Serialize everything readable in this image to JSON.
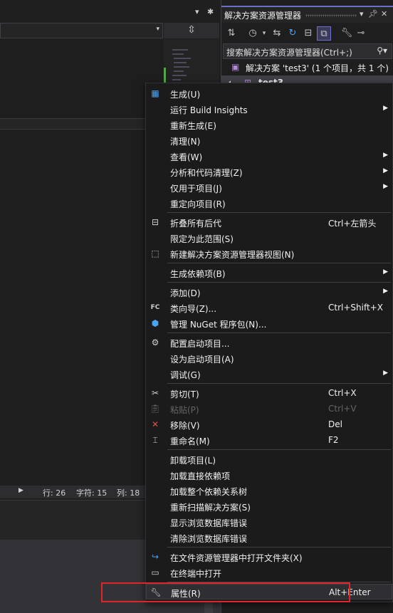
{
  "colors": {
    "menu_bg": "#1b1b1c",
    "highlight_box": "#e0242a",
    "accent": "#6e6ecc",
    "text": "#f1f1f1",
    "disabled_text": "#656565"
  },
  "editor": {
    "split_icon": "split-icon",
    "status": {
      "line": "行: 26",
      "char": "字符: 15",
      "col": "列: 18"
    }
  },
  "solution_explorer": {
    "title": "解决方案资源管理器",
    "search_placeholder": "搜索解决方案资源管理器(Ctrl+;)",
    "solution_label": "解决方案 'test3' (1 个项目，共 1 个)",
    "project_label": "test3"
  },
  "context_menu": {
    "items": [
      {
        "label": "生成(U)",
        "shortcut": "",
        "submenu": false,
        "icon": "build-icon"
      },
      {
        "label": "运行 Build Insights",
        "shortcut": "",
        "submenu": true,
        "icon": ""
      },
      {
        "label": "重新生成(E)",
        "shortcut": "",
        "submenu": false,
        "icon": ""
      },
      {
        "label": "清理(N)",
        "shortcut": "",
        "submenu": false,
        "icon": ""
      },
      {
        "label": "查看(W)",
        "shortcut": "",
        "submenu": true,
        "icon": ""
      },
      {
        "label": "分析和代码清理(Z)",
        "shortcut": "",
        "submenu": true,
        "icon": ""
      },
      {
        "label": "仅用于项目(J)",
        "shortcut": "",
        "submenu": true,
        "icon": ""
      },
      {
        "label": "重定向项目(R)",
        "shortcut": "",
        "submenu": false,
        "icon": ""
      },
      {
        "label": "折叠所有后代",
        "shortcut": "Ctrl+左箭头",
        "submenu": false,
        "icon": "collapse-icon"
      },
      {
        "label": "限定为此范围(S)",
        "shortcut": "",
        "submenu": false,
        "icon": ""
      },
      {
        "label": "新建解决方案资源管理器视图(N)",
        "shortcut": "",
        "submenu": false,
        "icon": "new-view-icon"
      },
      {
        "label": "生成依赖项(B)",
        "shortcut": "",
        "submenu": true,
        "icon": ""
      },
      {
        "label": "添加(D)",
        "shortcut": "",
        "submenu": true,
        "icon": ""
      },
      {
        "label": "类向导(Z)...",
        "shortcut": "Ctrl+Shift+X",
        "submenu": false,
        "icon": "class-wizard-icon"
      },
      {
        "label": "管理 NuGet 程序包(N)...",
        "shortcut": "",
        "submenu": false,
        "icon": "nuget-icon"
      },
      {
        "label": "配置启动项目...",
        "shortcut": "",
        "submenu": false,
        "icon": "gear-icon"
      },
      {
        "label": "设为启动项目(A)",
        "shortcut": "",
        "submenu": false,
        "icon": ""
      },
      {
        "label": "调试(G)",
        "shortcut": "",
        "submenu": true,
        "icon": ""
      },
      {
        "label": "剪切(T)",
        "shortcut": "Ctrl+X",
        "submenu": false,
        "icon": "scissors-icon"
      },
      {
        "label": "粘贴(P)",
        "shortcut": "Ctrl+V",
        "submenu": false,
        "icon": "paste-icon",
        "disabled": true
      },
      {
        "label": "移除(V)",
        "shortcut": "Del",
        "submenu": false,
        "icon": "remove-icon"
      },
      {
        "label": "重命名(M)",
        "shortcut": "F2",
        "submenu": false,
        "icon": "rename-icon"
      },
      {
        "label": "卸载项目(L)",
        "shortcut": "",
        "submenu": false,
        "icon": ""
      },
      {
        "label": "加载直接依赖项",
        "shortcut": "",
        "submenu": false,
        "icon": ""
      },
      {
        "label": "加载整个依赖关系树",
        "shortcut": "",
        "submenu": false,
        "icon": ""
      },
      {
        "label": "重新扫描解决方案(S)",
        "shortcut": "",
        "submenu": false,
        "icon": ""
      },
      {
        "label": "显示浏览数据库错误",
        "shortcut": "",
        "submenu": false,
        "icon": ""
      },
      {
        "label": "清除浏览数据库错误",
        "shortcut": "",
        "submenu": false,
        "icon": ""
      },
      {
        "label": "在文件资源管理器中打开文件夹(X)",
        "shortcut": "",
        "submenu": false,
        "icon": "open-folder-icon"
      },
      {
        "label": "在终端中打开",
        "shortcut": "",
        "submenu": false,
        "icon": "terminal-icon"
      },
      {
        "label": "属性(R)",
        "shortcut": "Alt+Enter",
        "submenu": false,
        "icon": "wrench-icon",
        "highlighted": true
      }
    ]
  }
}
